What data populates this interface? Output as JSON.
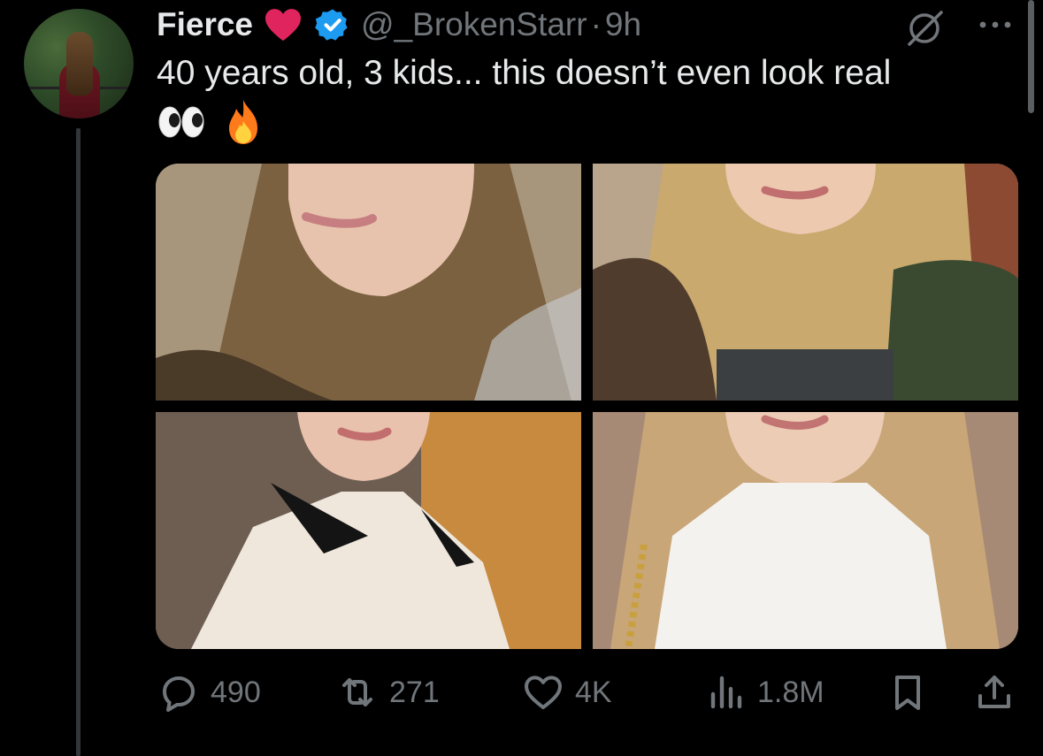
{
  "post": {
    "author_name": "Fierce",
    "handle": "@_BrokenStarr",
    "separator": "·",
    "timestamp": "9h",
    "text": "40 years old, 3 kids... this doesn’t even look real",
    "emojis": "👀🔥"
  },
  "media": {
    "images": [
      {
        "alt": "photo-1"
      },
      {
        "alt": "photo-2"
      },
      {
        "alt": "photo-3"
      },
      {
        "alt": "photo-4"
      }
    ]
  },
  "actions": {
    "replies": "490",
    "reposts": "271",
    "likes": "4K",
    "views": "1.8M"
  },
  "icons": {
    "heart_emoji": "red-heart-emoji",
    "verified": "verified-badge-icon",
    "grok": "grok-icon",
    "more": "more-dots-icon",
    "reply": "reply-icon",
    "repost": "repost-icon",
    "like": "like-icon",
    "views": "views-icon",
    "bookmark": "bookmark-icon",
    "share": "share-icon"
  },
  "colors": {
    "background": "#000000",
    "text_primary": "#e7e9ea",
    "text_secondary": "#71767b",
    "verified_blue": "#1d9bf0",
    "heart_red": "#e0245e"
  }
}
